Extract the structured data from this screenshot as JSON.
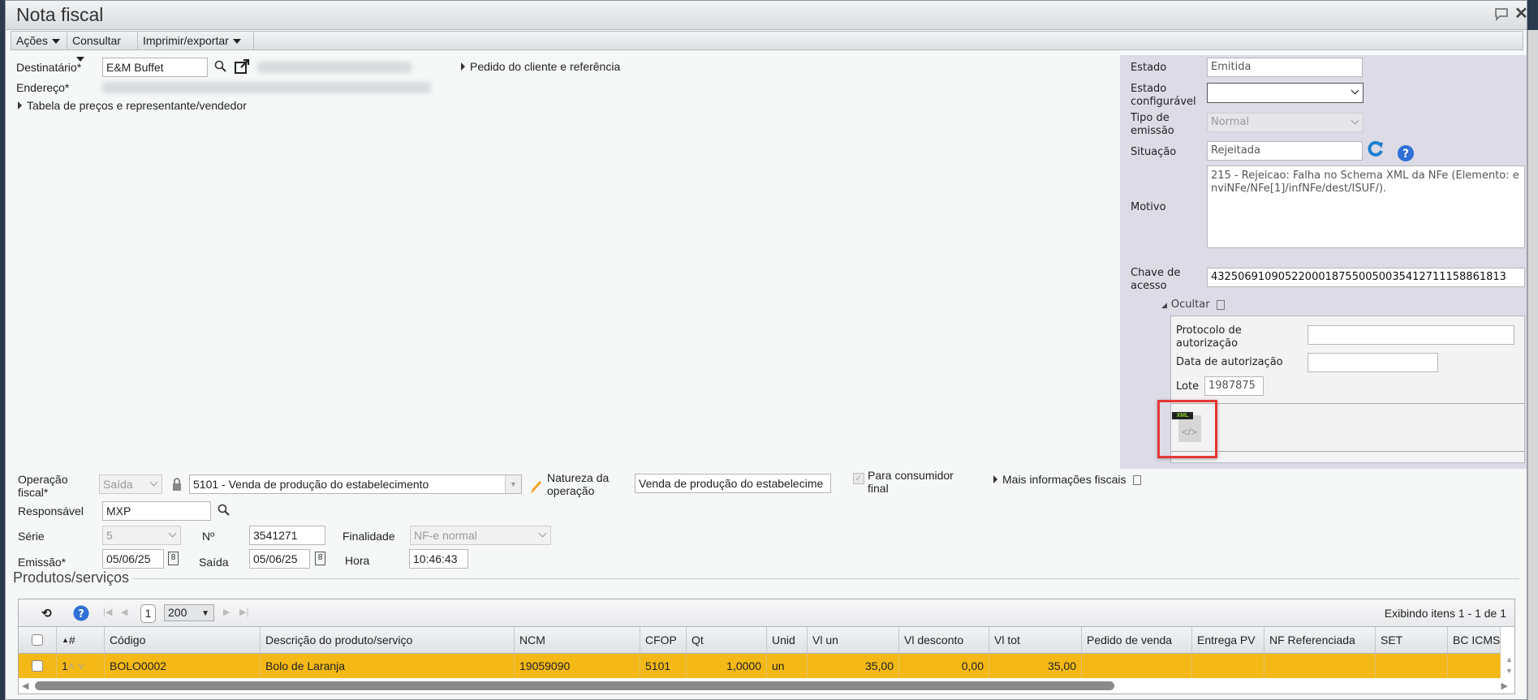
{
  "window": {
    "title": "Nota fiscal"
  },
  "menu": [
    {
      "label": "Ações"
    },
    {
      "label": "Consultar"
    },
    {
      "label": "Imprimir/exportar"
    }
  ],
  "form": {
    "destinatario_label": "Destinatário*",
    "destinatario_value": "E&M Buffet",
    "endereco_label": "Endereço*",
    "pedido_cliente_link": "Pedido do cliente e referência",
    "tabela_link": "Tabela de preços e representante/vendedor",
    "operacao_label_1": "Operação",
    "operacao_label_2": "fiscal*",
    "operacao_tipo": "Saída",
    "operacao_value": "5101 - Venda de produção do estabelecimento",
    "natureza_label_1": "Natureza da",
    "natureza_label_2": "operação",
    "natureza_value": "Venda de produção do estabelecime",
    "consumidor_final_1": "Para consumidor",
    "consumidor_final_2": "final",
    "consumidor_final_checked": true,
    "mais_info_link": "Mais informações fiscais",
    "responsavel_label": "Responsável",
    "responsavel_value": "MXP",
    "serie_label": "Série",
    "serie_value": "5",
    "numero_label": "Nº",
    "numero_value": "3541271",
    "finalidade_label": "Finalidade",
    "finalidade_value": "NF-e normal",
    "emissao_label": "Emissão*",
    "emissao_value": "05/06/25",
    "saida_label": "Saída",
    "saida_value": "05/06/25",
    "hora_label": "Hora",
    "hora_value": "10:46:43"
  },
  "status_panel": {
    "estado_label": "Estado",
    "estado_value": "Emitida",
    "estado_config_label_1": "Estado",
    "estado_config_label_2": "configurável",
    "estado_config_value": "",
    "tipo_emissao_label_1": "Tipo de",
    "tipo_emissao_label_2": "emissão",
    "tipo_emissao_value": "Normal",
    "situacao_label": "Situação",
    "situacao_value": "Rejeitada",
    "motivo_label": "Motivo",
    "motivo_value": "215 - Rejeicao: Falha no Schema XML da NFe (Elemento: enviNFe/NFe[1]/infNFe/dest/ISUF/).",
    "chave_label_1": "Chave de",
    "chave_label_2": "acesso",
    "chave_value": "43250691090522000187550050035412711158861813",
    "ocultar_label": "Ocultar",
    "protocolo_label_1": "Protocolo de",
    "protocolo_label_2": "autorização",
    "protocolo_value": "",
    "data_autorizacao_label": "Data de autorização",
    "data_autorizacao_value": "",
    "lote_label": "Lote",
    "lote_value": "1987875",
    "xml_icon_text": "XML",
    "highlight_color": "#e53935"
  },
  "products": {
    "section_title": "Produtos/serviços",
    "page": "1",
    "page_size": "200",
    "info": "Exibindo itens 1 - 1 de 1",
    "row_highlight_color": "#f4b916",
    "columns": [
      "",
      "#",
      "Código",
      "Descrição do produto/serviço",
      "NCM",
      "CFOP",
      "Qt",
      "Unid",
      "Vl un",
      "Vl desconto",
      "Vl tot",
      "Pedido de venda",
      "Entrega PV",
      "NF Referenciada",
      "SET",
      "BC ICMS"
    ],
    "rows": [
      [
        "",
        "1",
        "BOLO0002",
        "Bolo de Laranja",
        "19059090",
        "5101",
        "1,0000",
        "un",
        "35,00",
        "0,00",
        "35,00",
        "",
        "",
        "",
        "",
        ""
      ]
    ]
  }
}
